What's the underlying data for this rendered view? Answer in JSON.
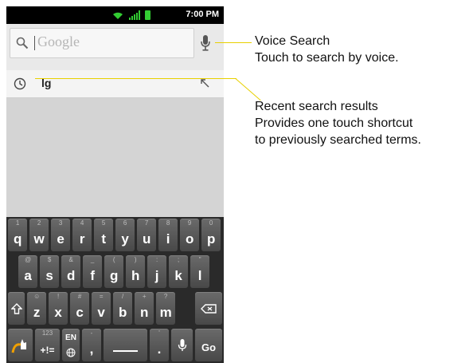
{
  "status_bar": {
    "time": "7:00 PM",
    "icons": [
      "wifi-icon",
      "signal-icon",
      "battery-icon"
    ],
    "battery_color": "#33cc33"
  },
  "search": {
    "placeholder": "Google",
    "icon": "search-icon",
    "mic_icon": "microphone-icon"
  },
  "suggestion": {
    "text": "lg",
    "icon": "clock-icon",
    "action_icon": "arrow-up-left-icon"
  },
  "keyboard": {
    "row1": [
      {
        "main": "q",
        "sub": "1"
      },
      {
        "main": "w",
        "sub": "2"
      },
      {
        "main": "e",
        "sub": "3"
      },
      {
        "main": "r",
        "sub": "4"
      },
      {
        "main": "t",
        "sub": "5"
      },
      {
        "main": "y",
        "sub": "6"
      },
      {
        "main": "u",
        "sub": "7"
      },
      {
        "main": "i",
        "sub": "8"
      },
      {
        "main": "o",
        "sub": "9"
      },
      {
        "main": "p",
        "sub": "0"
      }
    ],
    "row2": [
      {
        "main": "a",
        "sub": "@"
      },
      {
        "main": "s",
        "sub": "$"
      },
      {
        "main": "d",
        "sub": "&"
      },
      {
        "main": "f",
        "sub": "_"
      },
      {
        "main": "g",
        "sub": "("
      },
      {
        "main": "h",
        "sub": ")"
      },
      {
        "main": "j",
        "sub": ":"
      },
      {
        "main": "k",
        "sub": ";"
      },
      {
        "main": "l",
        "sub": "\""
      }
    ],
    "row3": [
      {
        "main": "z",
        "sub": "☺"
      },
      {
        "main": "x",
        "sub": "!"
      },
      {
        "main": "c",
        "sub": "#"
      },
      {
        "main": "v",
        "sub": "="
      },
      {
        "main": "b",
        "sub": "/"
      },
      {
        "main": "n",
        "sub": "+"
      },
      {
        "main": "m",
        "sub": "?"
      }
    ],
    "bottom": {
      "symbols_main": "+!=",
      "symbols_sub": "123",
      "lang_label": "EN",
      "comma_main": ",",
      "comma_sub": "-",
      "period_main": ".",
      "period_sub": "'",
      "go_label": "Go"
    },
    "accent_color": "#f0a000"
  },
  "callouts": {
    "voice_title": "Voice Search",
    "voice_desc": "Touch to search by voice.",
    "recent_title": "Recent search results",
    "recent_desc1": "Provides one touch shortcut",
    "recent_desc2": "to previously searched terms.",
    "line_color": "#e8d000"
  }
}
